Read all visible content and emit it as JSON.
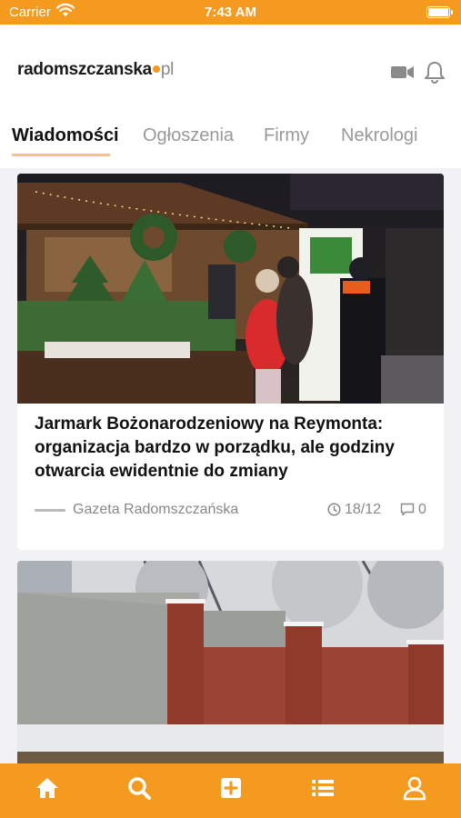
{
  "status": {
    "carrier": "Carrier",
    "time": "7:43 AM"
  },
  "header": {
    "logo_main": "radomszczanska",
    "logo_tld": "pl",
    "video_icon": "video-camera-icon",
    "bell_icon": "bell-icon"
  },
  "tabs": [
    {
      "label": "Wiadomości",
      "active": true
    },
    {
      "label": "Ogłoszenia",
      "active": false
    },
    {
      "label": "Firmy",
      "active": false
    },
    {
      "label": "Nekrologi",
      "active": false
    }
  ],
  "articles": [
    {
      "title": "Jarmark Bożonarodzeniowy na Reymonta: organizacja bardzo w porządku, ale godziny otwarcia ewidentnie do zmiany",
      "source": "Gazeta Radomszczańska",
      "date": "18/12",
      "comments": "0",
      "image": "christmas-market-photo"
    },
    {
      "image": "snowy-brick-wall-photo"
    }
  ],
  "nav": [
    {
      "name": "home",
      "icon": "home-icon"
    },
    {
      "name": "search",
      "icon": "search-icon"
    },
    {
      "name": "add",
      "icon": "plus-square-icon"
    },
    {
      "name": "list",
      "icon": "list-icon"
    },
    {
      "name": "profile",
      "icon": "user-icon"
    }
  ],
  "colors": {
    "accent": "#f39a1f",
    "tab_underline": "#f5c38a",
    "background": "#f2f2f4"
  }
}
